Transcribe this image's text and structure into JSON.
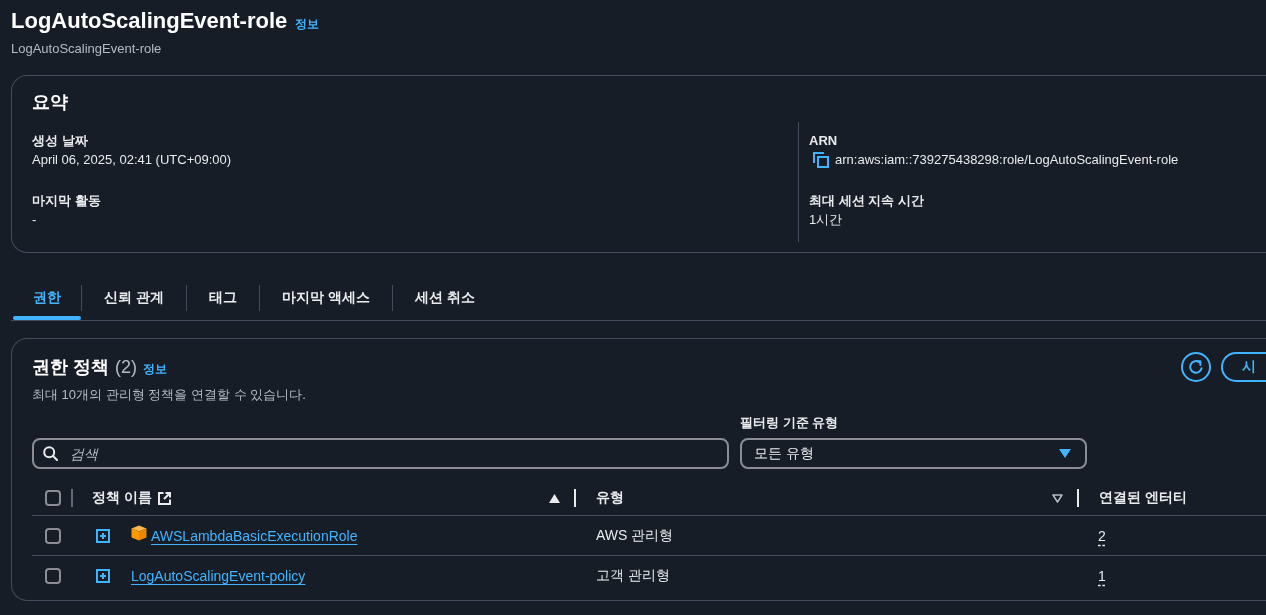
{
  "page": {
    "title": "LogAutoScalingEvent-role",
    "info_link": "정보",
    "subtitle": "LogAutoScalingEvent-role"
  },
  "summary": {
    "title": "요약",
    "columns": [
      {
        "fields": [
          {
            "label": "생성 날짜",
            "value": "April 06, 2025, 02:41 (UTC+09:00)",
            "copyable": false
          },
          {
            "label": "마지막 활동",
            "value": "-",
            "copyable": false
          }
        ]
      },
      {
        "fields": [
          {
            "label": "ARN",
            "value": "arn:aws:iam::739275438298:role/LogAutoScalingEvent-role",
            "copyable": true
          },
          {
            "label": "최대 세션 지속 시간",
            "value": "1시간",
            "copyable": false
          }
        ]
      }
    ]
  },
  "tabs": [
    {
      "label": "권한",
      "selected": true
    },
    {
      "label": "신뢰 관계",
      "selected": false
    },
    {
      "label": "태그",
      "selected": false
    },
    {
      "label": "마지막 액세스",
      "selected": false
    },
    {
      "label": "세션 취소",
      "selected": false
    }
  ],
  "policies": {
    "title": "권한 정책",
    "count": "(2)",
    "info_link": "정보",
    "description": "최대 10개의 관리형 정책을 연결할 수 있습니다.",
    "action_button": "시",
    "search": {
      "placeholder": "검색"
    },
    "filter": {
      "label": "필터링 기준 유형",
      "value": "모든 유형"
    },
    "table": {
      "all_selected": false,
      "columns": [
        {
          "label": "정책 이름",
          "external_link": true,
          "sortable": true,
          "sorted": true
        },
        {
          "label": "유형",
          "external_link": false,
          "sortable": true,
          "sorted": false
        },
        {
          "label": "연결된 엔터티",
          "external_link": false,
          "sortable": false,
          "sorted": false
        }
      ],
      "rows": [
        {
          "selected": false,
          "expanded": false,
          "aws_managed": true,
          "name": "AWSLambdaBasicExecutionRole",
          "type": "AWS 관리형",
          "entities": "2"
        },
        {
          "selected": false,
          "expanded": false,
          "aws_managed": false,
          "name": "LogAutoScalingEvent-policy",
          "type": "고객 관리형",
          "entities": "1"
        }
      ]
    }
  }
}
